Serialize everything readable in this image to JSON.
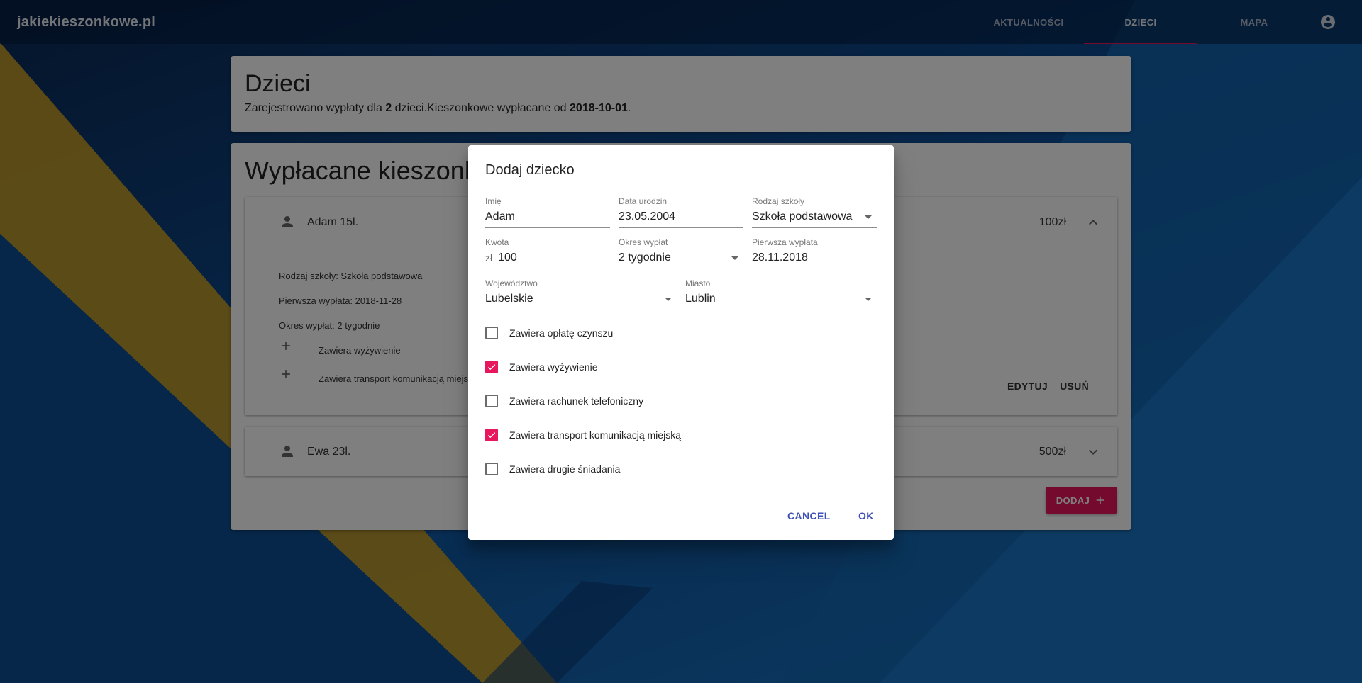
{
  "app": {
    "brand": "jakiekieszonkowe.pl"
  },
  "nav": {
    "items": [
      {
        "label": "AKTUALNOŚCI",
        "active": false
      },
      {
        "label": "DZIECI",
        "active": true
      },
      {
        "label": "MAPA",
        "active": false
      }
    ],
    "account_icon": "account-circle-icon"
  },
  "header_card": {
    "title": "Dzieci",
    "subtitle_pre": "Zarejestrowano wypłaty dla ",
    "child_count": "2",
    "subtitle_mid": " dzieci.Kieszonkowe wypłacane od ",
    "since_date": "2018-10-01",
    "subtitle_post": "."
  },
  "list_card": {
    "title": "Wypłacane kieszonkowe",
    "children": [
      {
        "name": "Adam 15l.",
        "amount": "100zł",
        "expanded": true,
        "details": [
          "Rodzaj szkoły: Szkoła podstawowa",
          "Pierwsza wypłata: 2018-11-28",
          "Okres wypłat: 2 tygodnie"
        ],
        "extras": [
          "Zawiera wyżywienie",
          "Zawiera transport komunikacją miejską"
        ],
        "edit_label": "EDYTUJ",
        "delete_label": "USUŃ"
      },
      {
        "name": "Ewa 23l.",
        "amount": "500zł",
        "expanded": false
      }
    ],
    "add_label": "DODAJ"
  },
  "dialog": {
    "title": "Dodaj dziecko",
    "fields": {
      "name": {
        "label": "Imię",
        "value": "Adam"
      },
      "birth_date": {
        "label": "Data urodzin",
        "value": "23.05.2004"
      },
      "school_type": {
        "label": "Rodzaj szkoły",
        "value": "Szkoła podstawowa"
      },
      "amount": {
        "label": "Kwota",
        "prefix": "zł",
        "value": "100"
      },
      "period": {
        "label": "Okres wypłat",
        "value": "2 tygodnie"
      },
      "first_payment": {
        "label": "Pierwsza wypłata",
        "value": "28.11.2018"
      },
      "voivodeship": {
        "label": "Województwo",
        "value": "Lubelskie"
      },
      "city": {
        "label": "Miasto",
        "value": "Lublin"
      }
    },
    "checkboxes": [
      {
        "label": "Zawiera opłatę czynszu",
        "checked": false
      },
      {
        "label": "Zawiera wyżywienie",
        "checked": true
      },
      {
        "label": "Zawiera rachunek telefoniczny",
        "checked": false
      },
      {
        "label": "Zawiera transport komunikacją miejską",
        "checked": true
      },
      {
        "label": "Zawiera drugie śniadania",
        "checked": false
      }
    ],
    "cancel_label": "CANCEL",
    "ok_label": "OK"
  },
  "colors": {
    "accent": "#e8175d",
    "primary": "#3f51b5",
    "stripe_gold": "#c9a227"
  }
}
